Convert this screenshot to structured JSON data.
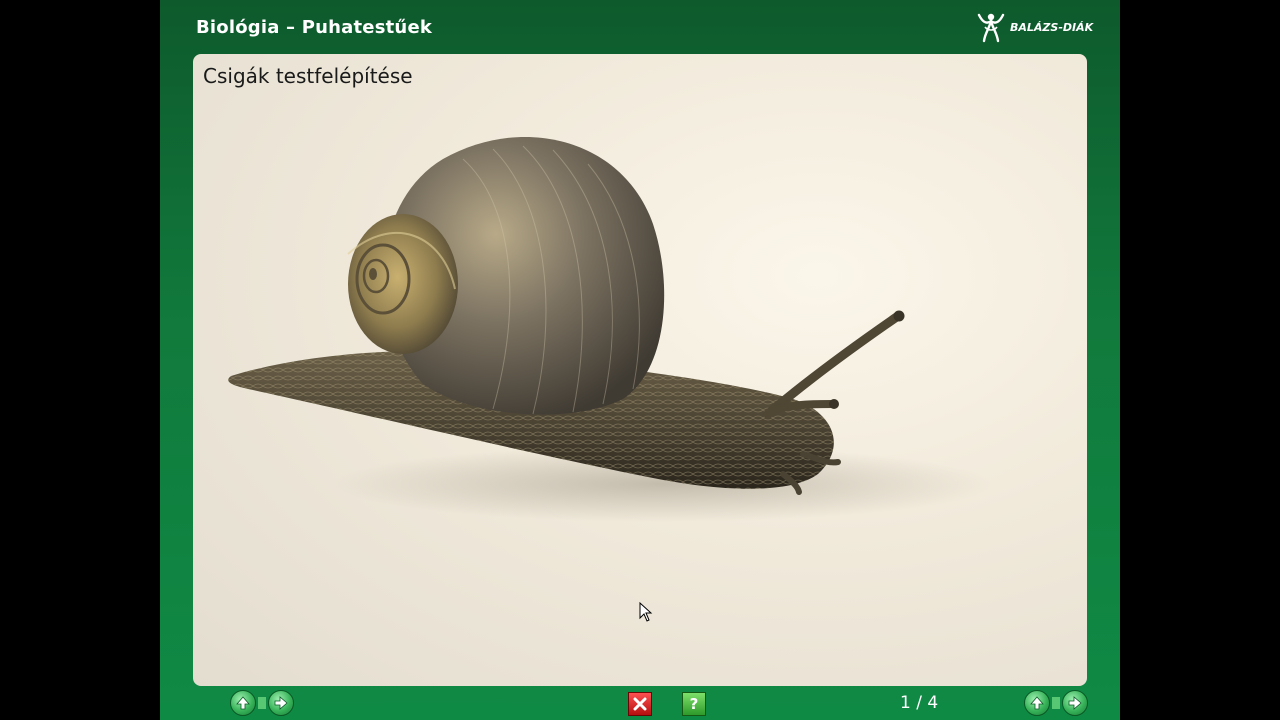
{
  "header": {
    "title": "Biológia – Puhatestűek",
    "logo_text": "BALÁZS-DIÁK"
  },
  "slide": {
    "title": "Csigák testfelépítése",
    "image_subject": "snail"
  },
  "footer": {
    "page_indicator": "1 / 4",
    "close_icon": "close-icon",
    "help_icon": "question-icon",
    "help_glyph": "?"
  },
  "colors": {
    "frame_green": "#117a3c",
    "content_bg": "#f1eadb",
    "close_red": "#d42020",
    "help_green": "#3aa832"
  }
}
